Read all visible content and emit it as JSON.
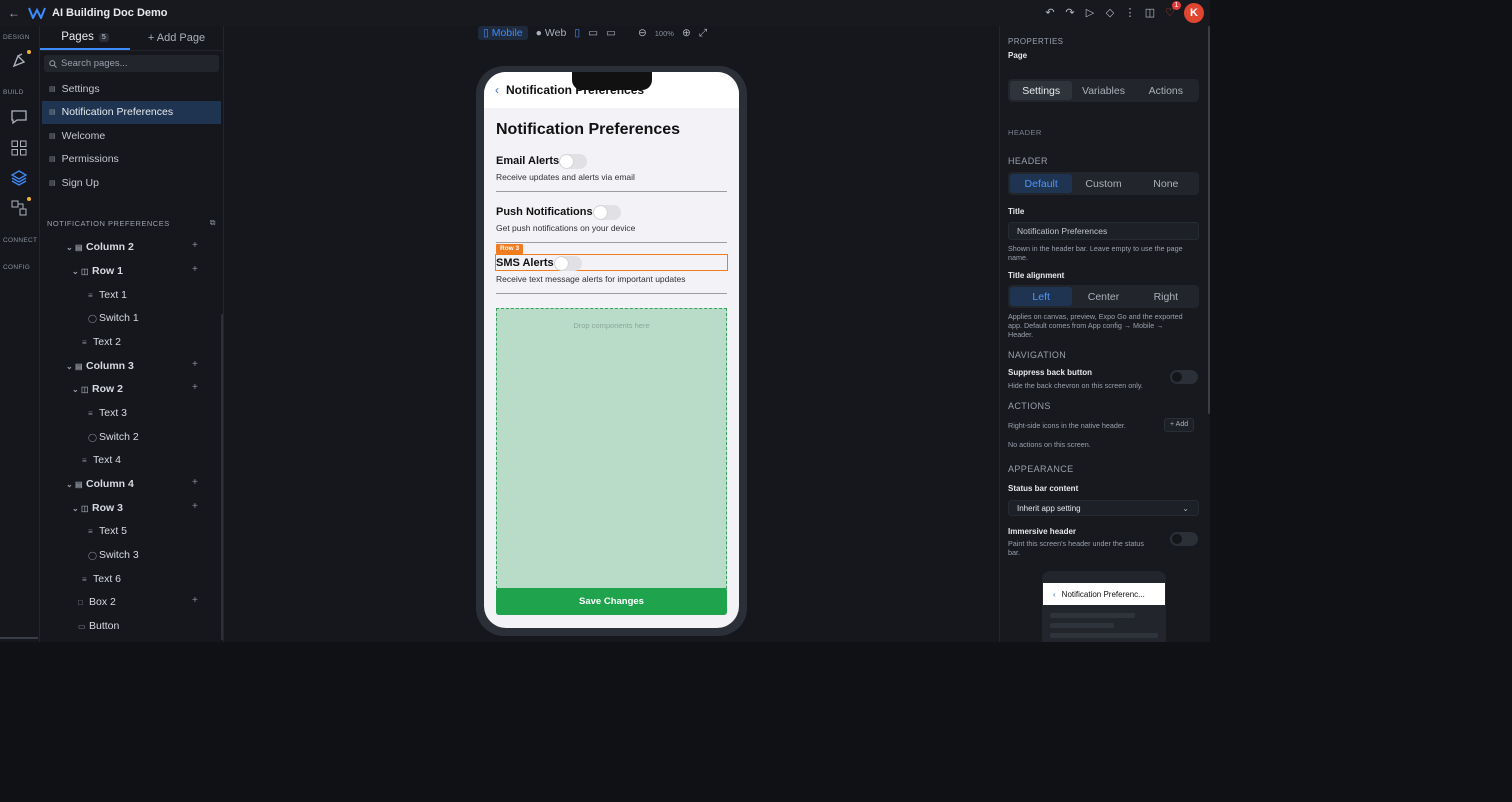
{
  "app": {
    "title": "AI Building Doc Demo",
    "avatar_initial": "K",
    "notification_count": "1",
    "accent": "#3d8bfd"
  },
  "rail": {
    "design_label": "DESIGN",
    "build_label": "BUILD",
    "connect_label": "CONNECT",
    "config_label": "CONFIG"
  },
  "pages_panel": {
    "tab_pages": "Pages",
    "pages_count": "5",
    "add_page": "+ Add Page",
    "search_placeholder": "Search pages...",
    "pages": [
      {
        "label": "Settings"
      },
      {
        "label": "Notification Preferences"
      },
      {
        "label": "Welcome"
      },
      {
        "label": "Permissions"
      },
      {
        "label": "Sign Up"
      }
    ],
    "tree_header": "NOTIFICATION PREFERENCES",
    "tree": [
      {
        "label": "Column 2"
      },
      {
        "label": "Row 1"
      },
      {
        "label": "Text 1"
      },
      {
        "label": "Switch 1"
      },
      {
        "label": "Text 2"
      },
      {
        "label": "Column 3"
      },
      {
        "label": "Row 2"
      },
      {
        "label": "Text 3"
      },
      {
        "label": "Switch 2"
      },
      {
        "label": "Text 4"
      },
      {
        "label": "Column 4"
      },
      {
        "label": "Row 3"
      },
      {
        "label": "Text 5"
      },
      {
        "label": "Switch 3"
      },
      {
        "label": "Text 6"
      },
      {
        "label": "Box 2"
      },
      {
        "label": "Button"
      }
    ]
  },
  "canvas": {
    "mode_mobile": "Mobile",
    "mode_web": "Web",
    "zoom": "100%",
    "phone": {
      "nav_title": "Notification Preferences",
      "page_title": "Notification Preferences",
      "settings": [
        {
          "label": "Email Alerts",
          "desc": "Receive updates and alerts via email"
        },
        {
          "label": "Push Notifications",
          "desc": "Get push notifications on your device"
        },
        {
          "label": "SMS Alerts",
          "desc": "Receive text message alerts for important updates"
        }
      ],
      "selected_tag": "Row 3",
      "drop_text": "Drop components here",
      "save_button": "Save Changes",
      "save_color": "#1fa34c"
    }
  },
  "properties": {
    "heading": "PROPERTIES",
    "subheading": "Page",
    "tabs": [
      "Settings",
      "Variables",
      "Actions"
    ],
    "section_header": "HEADER",
    "header_label": "HEADER",
    "header_options": [
      "Default",
      "Custom",
      "None"
    ],
    "title_label": "Title",
    "title_value": "Notification Preferences",
    "title_help": "Shown in the header bar. Leave empty to use the page name.",
    "alignment_label": "Title alignment",
    "alignment_options": [
      "Left",
      "Center",
      "Right"
    ],
    "alignment_help": "Applies on canvas, preview, Expo Go and the exported app. Default comes from App config → Mobile → Header.",
    "navigation_label": "NAVIGATION",
    "suppress_label": "Suppress back button",
    "suppress_help": "Hide the back chevron on this screen only.",
    "actions_label": "ACTIONS",
    "actions_help": "Right-side icons in the native header.",
    "actions_add": "+ Add",
    "actions_empty": "No actions on this screen.",
    "appearance_label": "APPEARANCE",
    "status_bar_label": "Status bar content",
    "status_bar_value": "Inherit app setting",
    "immersive_label": "Immersive header",
    "immersive_help": "Paint this screen's header under the status bar.",
    "preview_title": "Notification Preferenc..."
  }
}
